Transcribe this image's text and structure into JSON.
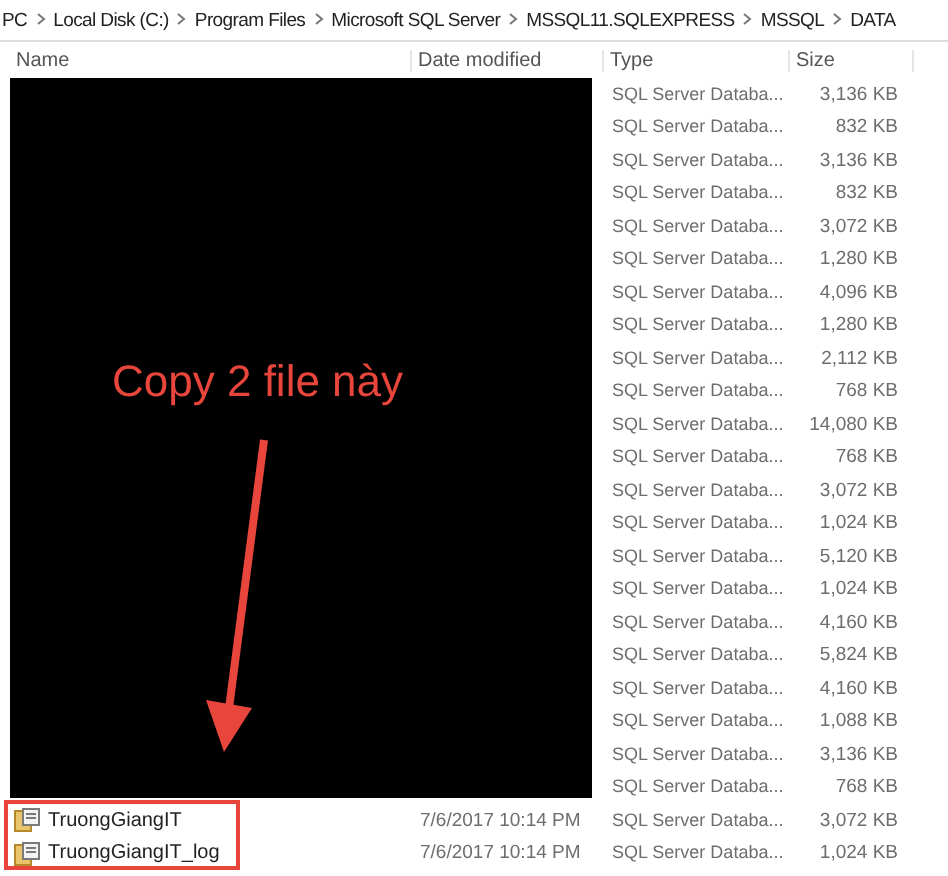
{
  "breadcrumb": [
    "PC",
    "Local Disk (C:)",
    "Program Files",
    "Microsoft SQL Server",
    "MSSQL11.SQLEXPRESS",
    "MSSQL",
    "DATA"
  ],
  "columns": [
    "Name",
    "Date modified",
    "Type",
    "Size"
  ],
  "rows": [
    {
      "type": "SQL Server Databa...",
      "size": "3,136 KB"
    },
    {
      "type": "SQL Server Databa...",
      "size": "832 KB"
    },
    {
      "type": "SQL Server Databa...",
      "size": "3,136 KB"
    },
    {
      "type": "SQL Server Databa...",
      "size": "832 KB"
    },
    {
      "type": "SQL Server Databa...",
      "size": "3,072 KB"
    },
    {
      "type": "SQL Server Databa...",
      "size": "1,280 KB"
    },
    {
      "type": "SQL Server Databa...",
      "size": "4,096 KB"
    },
    {
      "type": "SQL Server Databa...",
      "size": "1,280 KB"
    },
    {
      "type": "SQL Server Databa...",
      "size": "2,112 KB"
    },
    {
      "type": "SQL Server Databa...",
      "size": "768 KB"
    },
    {
      "type": "SQL Server Databa...",
      "size": "14,080 KB"
    },
    {
      "type": "SQL Server Databa...",
      "size": "768 KB"
    },
    {
      "type": "SQL Server Databa...",
      "size": "3,072 KB"
    },
    {
      "type": "SQL Server Databa...",
      "size": "1,024 KB"
    },
    {
      "type": "SQL Server Databa...",
      "size": "5,120 KB"
    },
    {
      "type": "SQL Server Databa...",
      "size": "1,024 KB"
    },
    {
      "type": "SQL Server Databa...",
      "size": "4,160 KB"
    },
    {
      "type": "SQL Server Databa...",
      "size": "5,824 KB"
    },
    {
      "type": "SQL Server Databa...",
      "size": "4,160 KB"
    },
    {
      "type": "SQL Server Databa...",
      "size": "1,088 KB"
    },
    {
      "type": "SQL Server Databa...",
      "size": "3,136 KB"
    },
    {
      "type": "SQL Server Databa...",
      "size": "768 KB"
    },
    {
      "name": "TruongGiangIT",
      "date": "7/6/2017 10:14 PM",
      "type": "SQL Server Databa...",
      "size": "3,072 KB"
    },
    {
      "name": "TruongGiangIT_log",
      "date": "7/6/2017 10:14 PM",
      "type": "SQL Server Databa...",
      "size": "1,024 KB"
    }
  ],
  "annotation": {
    "text": "Copy 2 file này"
  }
}
